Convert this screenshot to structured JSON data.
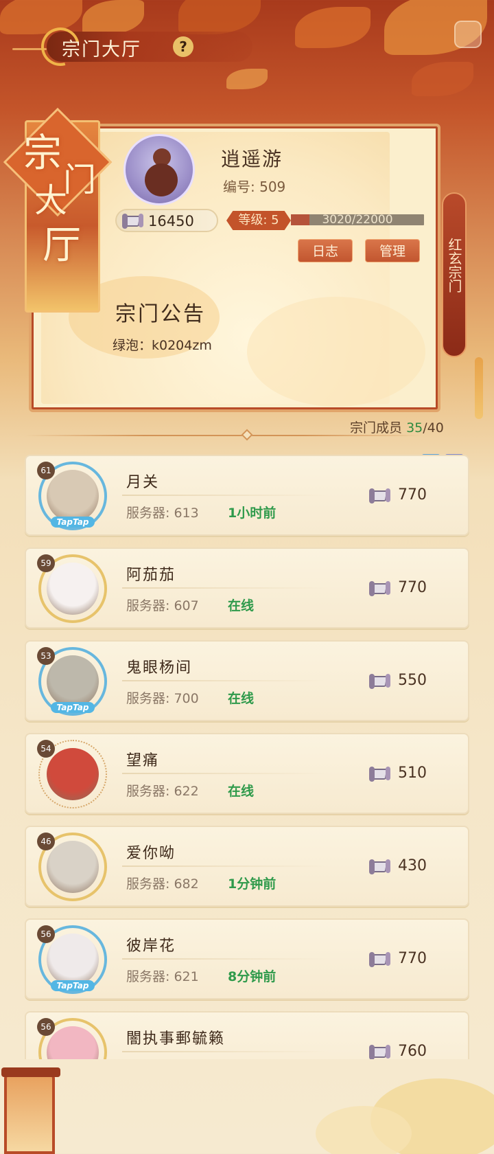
{
  "header": {
    "title": "宗门大厅",
    "help_icon": "?"
  },
  "hall_banner": {
    "chars": [
      "宗",
      "门",
      "大",
      "厅"
    ]
  },
  "sect": {
    "name": "逍遥游",
    "id_label": "编号: 509",
    "score": "16450",
    "level_label": "等级: 5",
    "exp_text": "3020/22000",
    "exp_fraction": 0.137,
    "log_button": "日志",
    "manage_button": "管理",
    "notice_title": "宗门公告",
    "notice_body": "绿泡：k0204zm",
    "banner_name": "红玄宗门"
  },
  "members_header": {
    "label": "宗门成员",
    "count": "35",
    "total": "/40"
  },
  "members": [
    {
      "level": "61",
      "name": "月关",
      "server": "服务器: 613",
      "status": "1小时前",
      "contribution": "770",
      "frame": "blue",
      "tap": "TapTap",
      "avatar_color": "#d8c9b4"
    },
    {
      "level": "59",
      "name": "阿茄茄",
      "server": "服务器: 607",
      "status": "在线",
      "contribution": "770",
      "frame": "gold",
      "tap": "",
      "avatar_color": "#f6f1f0"
    },
    {
      "level": "53",
      "name": "鬼眼杨间",
      "server": "服务器: 700",
      "status": "在线",
      "contribution": "550",
      "frame": "blue",
      "tap": "TapTap",
      "avatar_color": "#bdb8ab"
    },
    {
      "level": "54",
      "name": "望痛",
      "server": "服务器: 622",
      "status": "在线",
      "contribution": "510",
      "frame": "dotted",
      "tap": "",
      "avatar_color": "#d04a3c"
    },
    {
      "level": "46",
      "name": "爱你呦",
      "server": "服务器: 682",
      "status": "1分钟前",
      "contribution": "430",
      "frame": "gold",
      "tap": "",
      "avatar_color": "#d9d2c7"
    },
    {
      "level": "56",
      "name": "彼岸花",
      "server": "服务器: 621",
      "status": "8分钟前",
      "contribution": "770",
      "frame": "blue",
      "tap": "TapTap",
      "avatar_color": "#efeaea"
    },
    {
      "level": "56",
      "name": "闇执事郵毓籁",
      "server": "",
      "status": "",
      "contribution": "760",
      "frame": "gold",
      "tap": "",
      "avatar_color": "#f2b7c2"
    }
  ],
  "colors": {
    "accent": "#c3532a",
    "online": "#2f9a4b",
    "panel": "#fbefcd"
  }
}
